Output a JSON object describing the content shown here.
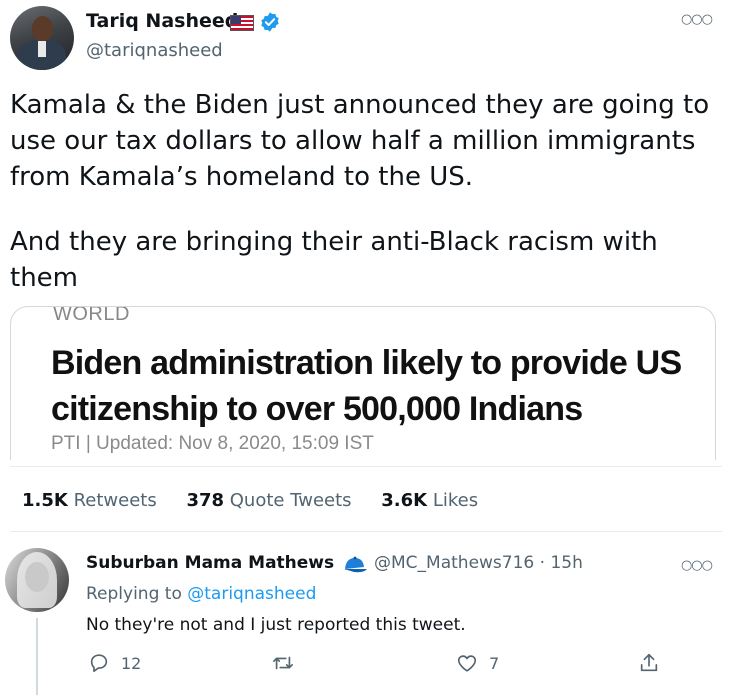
{
  "tweet": {
    "author_name": "Tariq Nasheed",
    "author_handle": "@tariqnasheed",
    "paragraphs": [
      "Kamala & the Biden just announced they are going to use our tax dollars to allow half a million immigrants from Kamala’s homeland to the US.",
      "And they are bringing their anti-Black racism with them"
    ],
    "card": {
      "tag": "WORLD",
      "headline": "Biden administration likely to provide US citizenship to over 500,000 Indians",
      "meta": "PTI | Updated: Nov 8, 2020, 15:09 IST"
    },
    "stats": {
      "retweets_count": "1.5K",
      "retweets_label": "Retweets",
      "quotes_count": "378",
      "quotes_label": "Quote Tweets",
      "likes_count": "3.6K",
      "likes_label": "Likes"
    }
  },
  "reply": {
    "author_name": "Suburban Mama Mathews",
    "handle_time": "@MC_Mathews716 · 15h",
    "replying_prefix": "Replying to",
    "replying_to": "@tariqnasheed",
    "text": "No they're not and I just reported this tweet.",
    "reply_count": "12",
    "retweet_count": "",
    "like_count": "7"
  },
  "colors": {
    "accent": "#1d9bf0",
    "muted": "#536471",
    "text": "#0f1419",
    "border": "#cfd9de"
  },
  "icons": [
    "flag-us-icon",
    "verified-badge-icon",
    "more-options-icon",
    "blue-cap-icon",
    "reply-icon",
    "retweet-icon",
    "like-icon",
    "share-icon"
  ]
}
